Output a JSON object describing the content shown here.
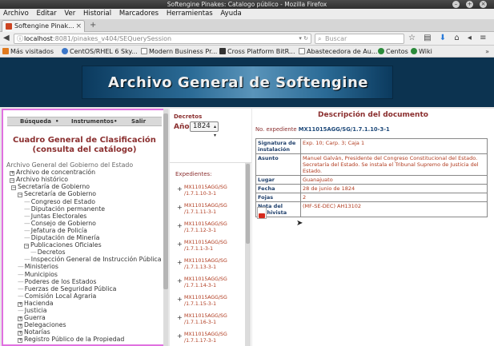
{
  "window": {
    "title": "Softengine Pinakes: Catalogo público - Mozilla Firefox"
  },
  "menu": [
    "Archivo",
    "Editar",
    "Ver",
    "Historial",
    "Marcadores",
    "Herramientas",
    "Ayuda"
  ],
  "tab": {
    "label": "Softengine Pinak...",
    "close": "×",
    "newtab": "+"
  },
  "url": {
    "host": "localhost",
    "path": ":8081/pinakes_v404/SEQuerySession"
  },
  "search": {
    "placeholder": "Buscar"
  },
  "bookmarks": [
    {
      "label": "Más visitados",
      "color": "#e07a1f"
    },
    {
      "label": "CentOS/RHEL 6 Sky...",
      "color": "#3a76c8"
    },
    {
      "label": "Modern Business Pr...",
      "color": "#ffffff"
    },
    {
      "label": "Cross Platform BitR...",
      "color": "#333333"
    },
    {
      "label": "Abastecedora de Au...",
      "color": "#ffffff"
    },
    {
      "label": "Centos",
      "color": "#2a8a3a"
    },
    {
      "label": "Wiki",
      "color": "#2a8a3a"
    }
  ],
  "banner": {
    "title": "Archivo General de Softengine"
  },
  "leftnav": {
    "links": [
      "Búsqueda",
      "Instrumentos",
      "Salir"
    ]
  },
  "cuadro": {
    "title1": "Cuadro General de Clasificación",
    "title2": "(consulta del catálogo)"
  },
  "tree": [
    {
      "t": "Archivo General del Gobierno del Estado",
      "d": 0,
      "i": ""
    },
    {
      "t": "Archivo de concentración",
      "d": 1,
      "i": "+"
    },
    {
      "t": "Archivo histórico",
      "d": 1,
      "i": "−"
    },
    {
      "t": "Secretaría de Gobierno",
      "d": 2,
      "i": "−"
    },
    {
      "t": "Secretaría de Gobierno",
      "d": 3,
      "i": "−"
    },
    {
      "t": "Congreso del Estado",
      "d": 4,
      "i": "-"
    },
    {
      "t": "Diputación permanente",
      "d": 4,
      "i": "-"
    },
    {
      "t": "Juntas Electorales",
      "d": 4,
      "i": "-"
    },
    {
      "t": "Consejo de Gobierno",
      "d": 4,
      "i": "-"
    },
    {
      "t": "Jefatura de Policía",
      "d": 4,
      "i": "-"
    },
    {
      "t": "Diputación de Minería",
      "d": 4,
      "i": "-"
    },
    {
      "t": "Publicaciones Oficiales",
      "d": 4,
      "i": "−"
    },
    {
      "t": "Decretos",
      "d": 5,
      "i": "-"
    },
    {
      "t": "Inspección General de Instrucción Pública",
      "d": 4,
      "i": "-"
    },
    {
      "t": "Ministerios",
      "d": 3,
      "i": "-"
    },
    {
      "t": "Municipios",
      "d": 3,
      "i": "-"
    },
    {
      "t": "Poderes de los Estados",
      "d": 3,
      "i": "-"
    },
    {
      "t": "Fuerzas de Seguridad Pública",
      "d": 3,
      "i": "-"
    },
    {
      "t": "Comisión Local Agraria",
      "d": 3,
      "i": "-"
    },
    {
      "t": "Hacienda",
      "d": 3,
      "i": "+"
    },
    {
      "t": "Justicia",
      "d": 3,
      "i": "-"
    },
    {
      "t": "Guerra",
      "d": 3,
      "i": "+"
    },
    {
      "t": "Delegaciones",
      "d": 3,
      "i": "+"
    },
    {
      "t": "Notarías",
      "d": 3,
      "i": "+"
    },
    {
      "t": "Registro Público de la Propiedad",
      "d": 3,
      "i": "+"
    }
  ],
  "decretos": {
    "label": "Decretos",
    "anio_label": "Año:",
    "anio": "1824"
  },
  "expedientes": {
    "label": "Expedientes:",
    "items": [
      [
        "MX11015AGG/SG",
        "/1.7.1.10-3-1"
      ],
      [
        "MX11015AGG/SG",
        "/1.7.1.11-3-1"
      ],
      [
        "MX11015AGG/SG",
        "/1.7.1.12-3-1"
      ],
      [
        "MX11015AGG/SG",
        "/1.7.1.1-3-1"
      ],
      [
        "MX11015AGG/SG",
        "/1.7.1.13-3-1"
      ],
      [
        "MX11015AGG/SG",
        "/1.7.1.14-3-1"
      ],
      [
        "MX11015AGG/SG",
        "/1.7.1.15-3-1"
      ],
      [
        "MX11015AGG/SG",
        "/1.7.1.16-3-1"
      ],
      [
        "MX11015AGG/SG",
        "/1.7.1.17-3-1"
      ]
    ]
  },
  "descripcion": {
    "title": "Descripción del documento",
    "noexp_label": "No. expediente",
    "noexp_value": "MX11015AGG/SG/1.7.1.10-3-1",
    "fields": [
      {
        "k": "Signatura de instalación",
        "v": "Exp. 10; Carp. 3; Caja 1"
      },
      {
        "k": "Asunto",
        "v": "Manuel Galván, Presidente del Congreso Constitucional del Estado. Secretaría del Estado. Se instala el Tribunal Supremo de Justicia del Estado."
      },
      {
        "k": "Lugar",
        "v": "Guanajuato"
      },
      {
        "k": "Fecha",
        "v": "28 de junio de 1824"
      },
      {
        "k": "Fojas",
        "v": "2"
      },
      {
        "k": "Nota del archivista",
        "v": "(MF-SE-DEC) AH13102"
      }
    ]
  }
}
